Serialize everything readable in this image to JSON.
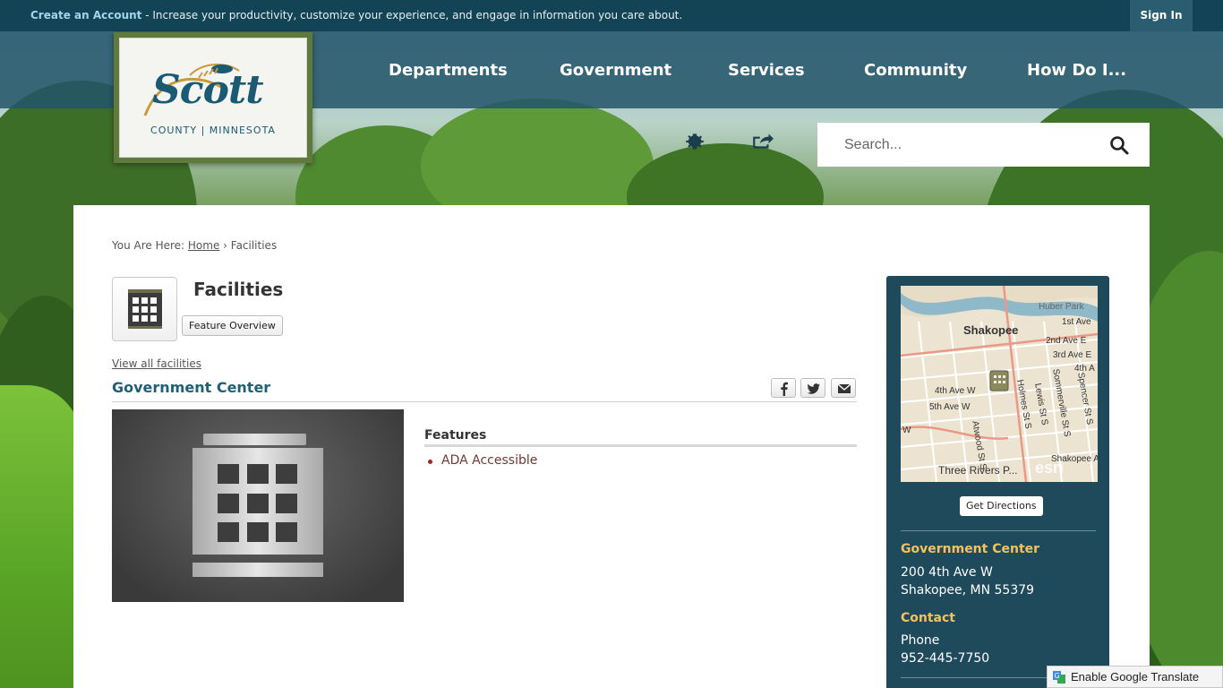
{
  "topbar": {
    "create_account": "Create an Account",
    "message": " - Increase your productivity, customize your experience, and engage in information you care about.",
    "sign_in": "Sign In"
  },
  "logo": {
    "word": "Scott",
    "sub": "COUNTY | MINNESOTA"
  },
  "nav": {
    "items": [
      {
        "label": "Departments"
      },
      {
        "label": "Government"
      },
      {
        "label": "Services"
      },
      {
        "label": "Community"
      },
      {
        "label": "How Do I..."
      }
    ]
  },
  "search": {
    "placeholder": "Search..."
  },
  "breadcrumb": {
    "prefix": "You Are Here: ",
    "home": "Home",
    "separator": " › ",
    "current": "Facilities"
  },
  "facility": {
    "title": "Facilities",
    "feature_overview": "Feature Overview",
    "view_all": "View all facilities",
    "name": "Government Center",
    "features_heading": "Features",
    "features": [
      "ADA Accessible"
    ]
  },
  "sidebar": {
    "get_directions": "Get Directions",
    "location_heading": "Government Center",
    "address_line1": "200 4th Ave W",
    "address_line2": "Shakopee, MN 55379",
    "contact_heading": "Contact",
    "phone_label": "Phone",
    "phone": "952-445-7750"
  },
  "map": {
    "city": "Shakopee",
    "labels": {
      "huber_park": "Huber Park",
      "first_ave": "1st Ave",
      "second_ave": "2nd Ave E",
      "third_ave": "3rd Ave E",
      "fourth_a": "4th A",
      "fourth_ave_w": "4th Ave W",
      "fifth_ave_w": "5th Ave W",
      "atwood": "Atwood St S",
      "holmes": "Holmes St S",
      "lewis": "Lewis St S",
      "sommerville": "Sommerville St S",
      "spencer": "Spencer St S",
      "shakopee_ave": "Shakopee Ave",
      "w": "W",
      "three_rivers": "Three Rivers P...",
      "esri": "esri"
    }
  },
  "translate": {
    "label": "Enable Google Translate"
  },
  "colors": {
    "topbar": "#134456",
    "navbar": "#235569",
    "accent_heading": "#1f6077",
    "sidebar": "#1e4a5c",
    "sidebar_heading": "#f5c15b"
  }
}
